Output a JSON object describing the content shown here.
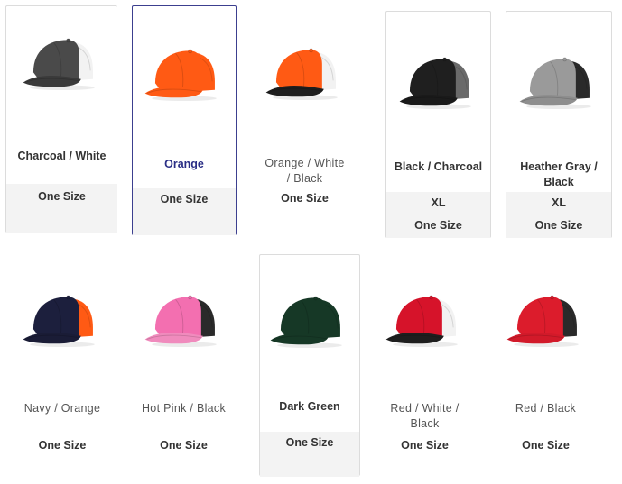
{
  "products": [
    {
      "name": "Charcoal / White",
      "sizes": [
        "One Size"
      ],
      "colors": {
        "front": "#4a4a4a",
        "mesh": "#f2f2f2",
        "brim": "#3a3a3a"
      }
    },
    {
      "name": "Orange",
      "sizes": [
        "One Size"
      ],
      "colors": {
        "front": "#ff5a14",
        "mesh": "#ff5a14",
        "brim": "#ff5a14"
      }
    },
    {
      "name": "Orange / White / Black",
      "sizes": [
        "One Size"
      ],
      "colors": {
        "front": "#ff5a14",
        "mesh": "#f2f2f2",
        "brim": "#1e1e1e"
      }
    },
    {
      "name": "Black / Charcoal",
      "sizes": [
        "XL",
        "One Size"
      ],
      "colors": {
        "front": "#1f1f1f",
        "mesh": "#6a6a6a",
        "brim": "#1a1a1a"
      }
    },
    {
      "name": "Heather Gray / Black",
      "sizes": [
        "XL",
        "One Size"
      ],
      "colors": {
        "front": "#9a9a9a",
        "mesh": "#2a2a2a",
        "brim": "#8e8e8e"
      }
    },
    {
      "name": "Navy / Orange",
      "sizes": [
        "One Size"
      ],
      "colors": {
        "front": "#1c1f3d",
        "mesh": "#ff5a14",
        "brim": "#1a1c36"
      }
    },
    {
      "name": "Hot Pink / Black",
      "sizes": [
        "One Size"
      ],
      "colors": {
        "front": "#f36fb0",
        "mesh": "#2a2a2a",
        "brim": "#f08bbd"
      }
    },
    {
      "name": "Dark Green",
      "sizes": [
        "One Size"
      ],
      "colors": {
        "front": "#163826",
        "mesh": "#163826",
        "brim": "#163826"
      }
    },
    {
      "name": "Red / White / Black",
      "sizes": [
        "One Size"
      ],
      "colors": {
        "front": "#d6132a",
        "mesh": "#f2f2f2",
        "brim": "#1e1e1e"
      }
    },
    {
      "name": "Red / Black",
      "sizes": [
        "One Size"
      ],
      "colors": {
        "front": "#dc1c2c",
        "mesh": "#2a2a2a",
        "brim": "#d21a2a"
      }
    }
  ]
}
